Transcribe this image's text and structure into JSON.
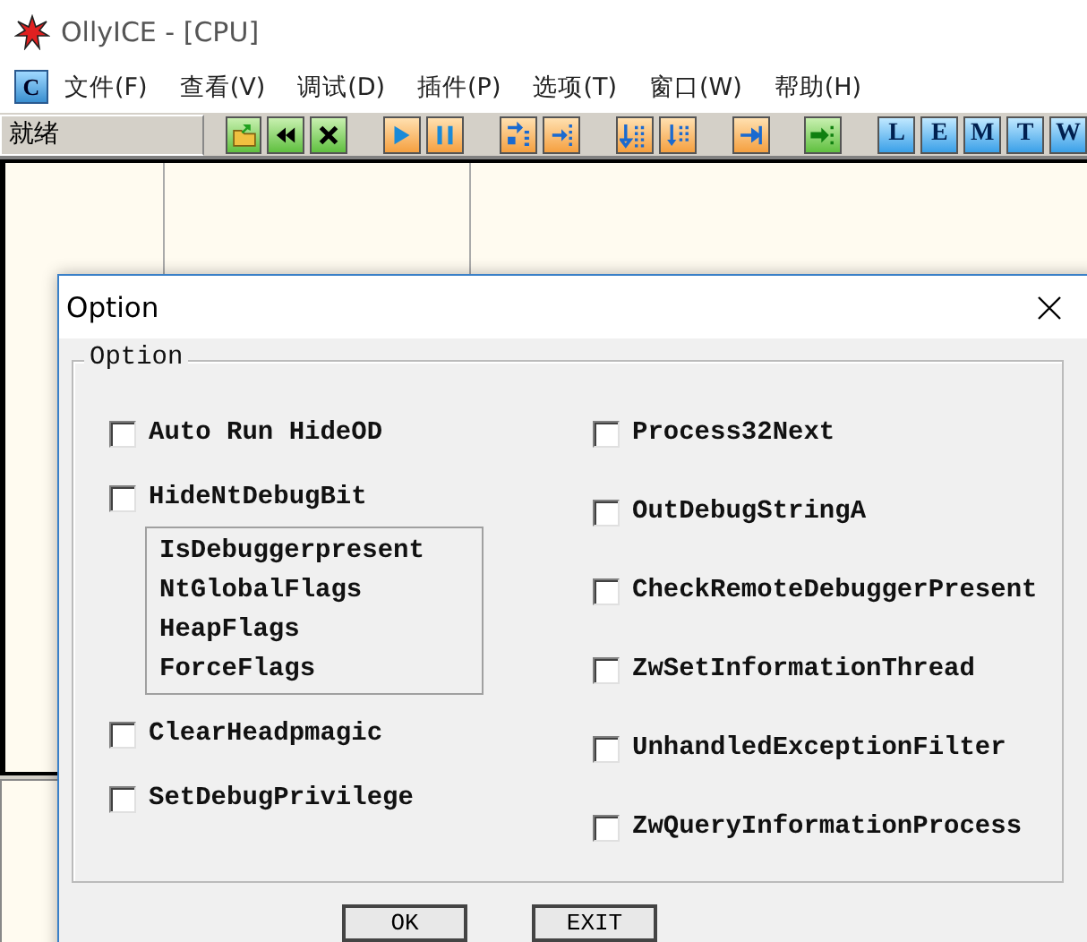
{
  "window": {
    "title": "OllyICE - [CPU]"
  },
  "app_button": "C",
  "menu": [
    {
      "label": "文件(F)"
    },
    {
      "label": "查看(V)"
    },
    {
      "label": "调试(D)"
    },
    {
      "label": "插件(P)"
    },
    {
      "label": "选项(T)"
    },
    {
      "label": "窗口(W)"
    },
    {
      "label": "帮助(H)"
    }
  ],
  "status": "就绪",
  "toolbar": [
    {
      "kind": "open"
    },
    {
      "kind": "rewind"
    },
    {
      "kind": "close"
    },
    {
      "kind": "gap"
    },
    {
      "kind": "run"
    },
    {
      "kind": "pause"
    },
    {
      "kind": "gap"
    },
    {
      "kind": "step_into"
    },
    {
      "kind": "step_over"
    },
    {
      "kind": "gap"
    },
    {
      "kind": "trace_into"
    },
    {
      "kind": "trace_over"
    },
    {
      "kind": "gap"
    },
    {
      "kind": "till_return"
    },
    {
      "kind": "gap"
    },
    {
      "kind": "goto"
    },
    {
      "kind": "gap"
    },
    {
      "kind": "letter",
      "label": "L"
    },
    {
      "kind": "letter",
      "label": "E"
    },
    {
      "kind": "letter",
      "label": "M"
    },
    {
      "kind": "letter",
      "label": "T"
    },
    {
      "kind": "letter",
      "label": "W"
    }
  ],
  "dialog": {
    "title": "Option",
    "group_title": "Option",
    "left_options": [
      {
        "label": "Auto Run HideOD",
        "checked": false
      },
      {
        "label": "HideNtDebugBit",
        "checked": false,
        "details": [
          "IsDebuggerpresent",
          "NtGlobalFlags",
          "HeapFlags",
          "ForceFlags"
        ]
      },
      {
        "label": "ClearHeadpmagic",
        "checked": false
      },
      {
        "label": "SetDebugPrivilege",
        "checked": false
      }
    ],
    "right_options": [
      {
        "label": "Process32Next",
        "checked": false
      },
      {
        "label": "OutDebugStringA",
        "checked": false
      },
      {
        "label": "CheckRemoteDebuggerPresent",
        "checked": false
      },
      {
        "label": "ZwSetInformationThread",
        "checked": false
      },
      {
        "label": "UnhandledExceptionFilter",
        "checked": false
      },
      {
        "label": "ZwQueryInformationProcess",
        "checked": false
      }
    ],
    "buttons": [
      "OK",
      "EXIT"
    ]
  }
}
